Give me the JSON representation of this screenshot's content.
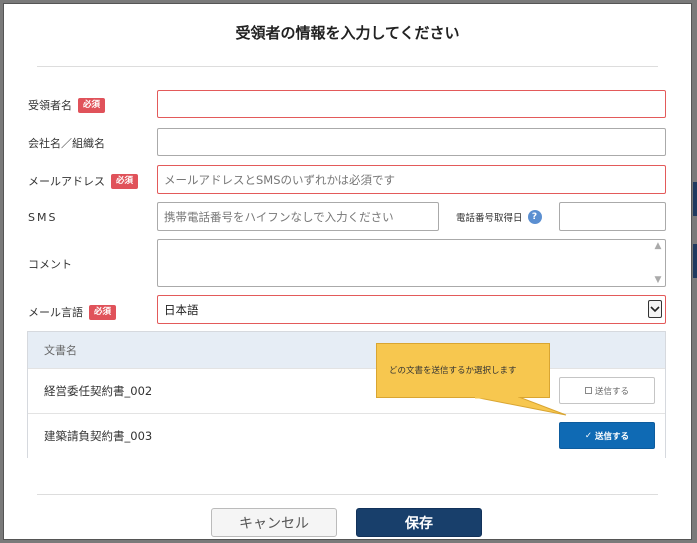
{
  "dialog": {
    "title": "受領者の情報を入力してください"
  },
  "form": {
    "required_badge": "必須",
    "recipient_name": {
      "label": "受領者名",
      "value": "",
      "placeholder": ""
    },
    "company": {
      "label": "会社名／組織名",
      "value": "",
      "placeholder": ""
    },
    "email": {
      "label": "メールアドレス",
      "value": "",
      "placeholder": "メールアドレスとSMSのいずれかは必須です"
    },
    "sms": {
      "label": "SMS",
      "value": "",
      "placeholder": "携帯電話番号をハイフンなしで入力ください"
    },
    "phone_date": {
      "label": "電話番号取得日",
      "help": "?",
      "value": ""
    },
    "comment": {
      "label": "コメント",
      "value": ""
    },
    "mail_language": {
      "label": "メール言語",
      "selected": "日本語",
      "arrow": "⌄"
    }
  },
  "documents": {
    "header": "文書名",
    "rows": [
      {
        "name": "経営委任契約書_002",
        "send_label": "送信する",
        "selected": false
      },
      {
        "name": "建築請負契約書_003",
        "send_label": "送信する",
        "selected": true
      }
    ],
    "check_mark": "✓"
  },
  "tooltip": {
    "text": "どの文書を送信するか選択します"
  },
  "footer": {
    "cancel_label": "キャンセル",
    "save_label": "保存"
  },
  "colors": {
    "accent": "#0f6ab4",
    "save": "#183f6b",
    "required": "#e0525a",
    "tooltip": "#f7c74f",
    "error_border": "#e35a5a"
  }
}
